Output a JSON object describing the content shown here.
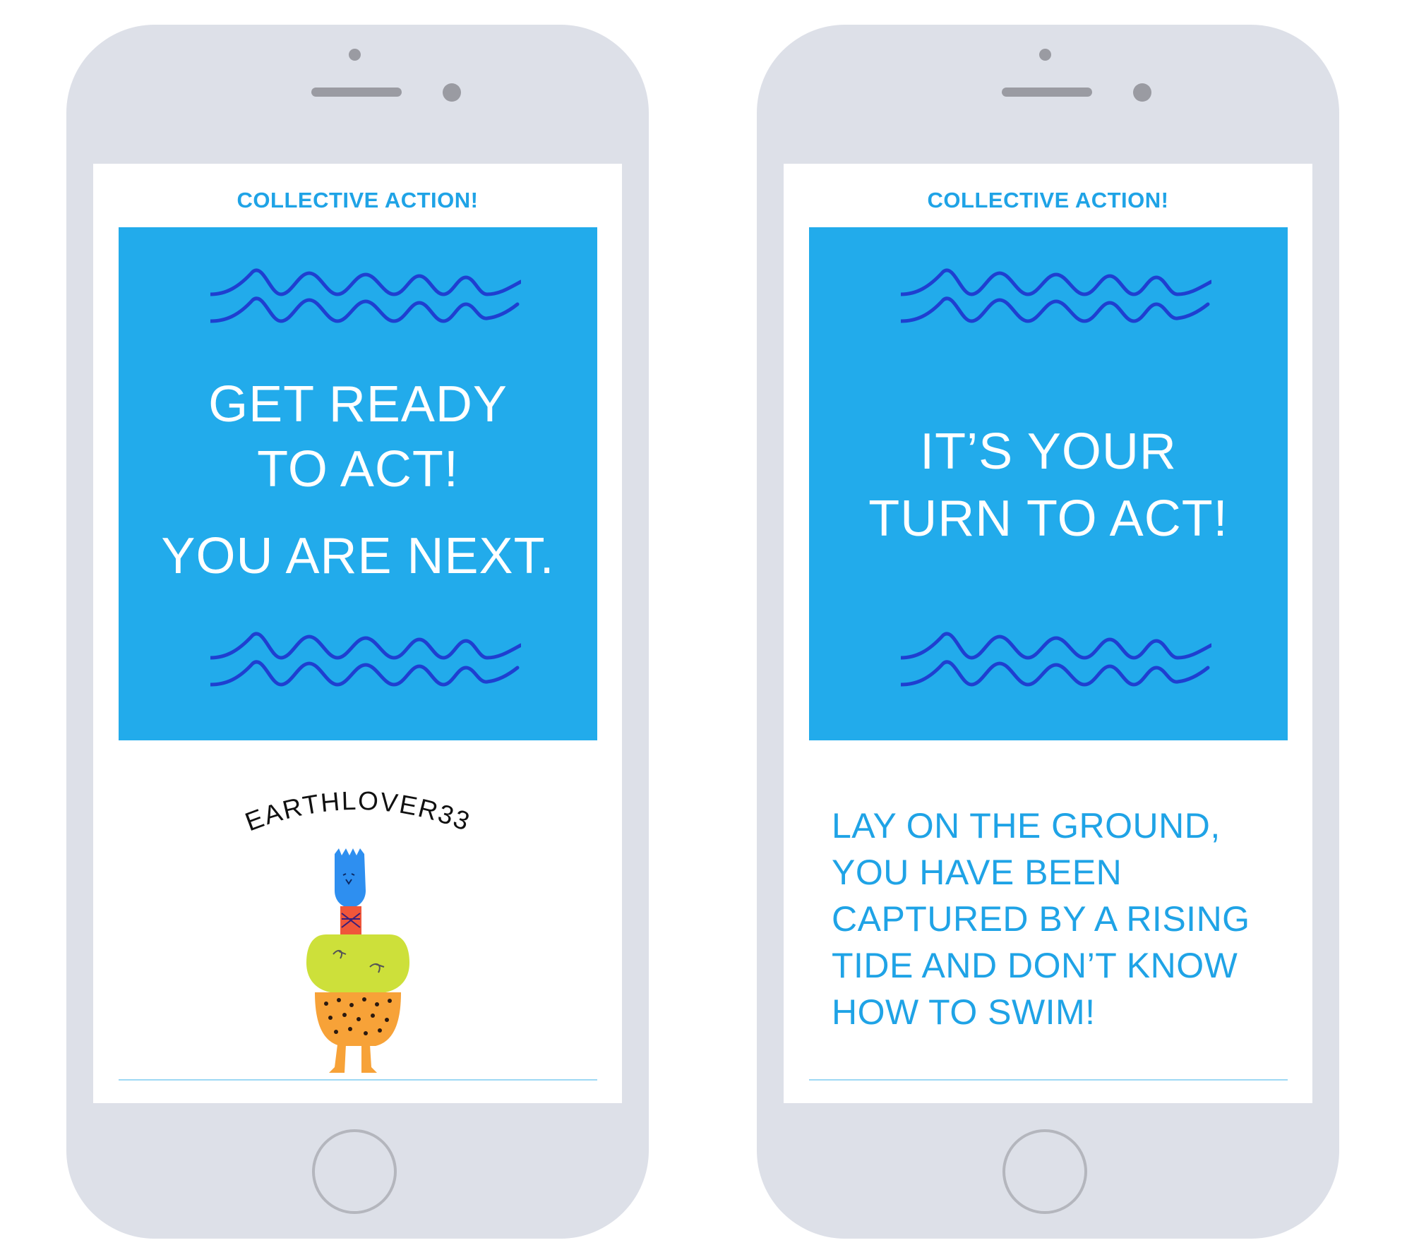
{
  "phones": [
    {
      "header": "COLLECTIVE ACTION!",
      "card_lines": [
        "GET READY",
        "TO ACT!",
        "YOU ARE NEXT."
      ],
      "username": "EARTHLOVER33"
    },
    {
      "header": "COLLECTIVE ACTION!",
      "card_lines": [
        "IT’S YOUR",
        "TURN TO ACT!"
      ],
      "instruction_lines": [
        "LAY ON THE GROUND,",
        "YOU HAVE BEEN",
        "CAPTURED BY A RISING",
        "TIDE AND DON’T KNOW",
        "HOW TO SWIM!"
      ]
    }
  ],
  "colors": {
    "phone_body": "#dde0e8",
    "card_blue": "#22abeb",
    "title_blue": "#1fa3e6",
    "wave_blue": "#1f3fd0"
  },
  "icons": {
    "waves": "wave-squiggle-icon",
    "avatar": "fork-head-character-illustration"
  }
}
